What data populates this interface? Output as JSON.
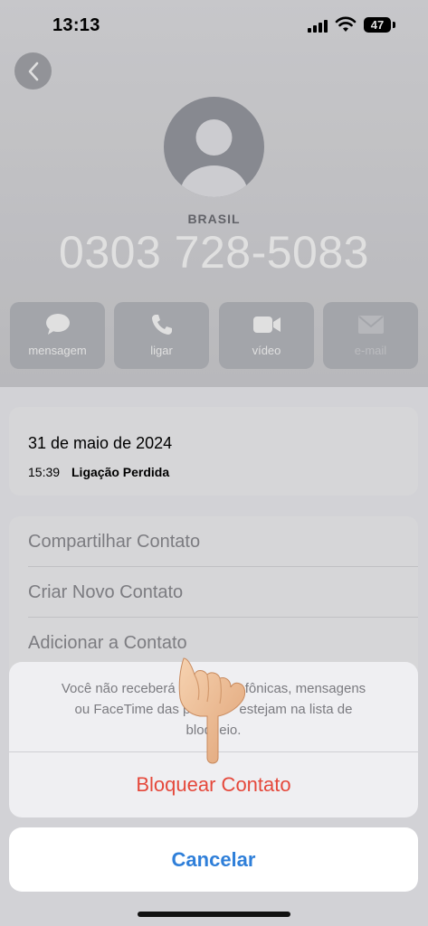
{
  "status_bar": {
    "time": "13:13",
    "battery": "47"
  },
  "contact": {
    "country": "BRASIL",
    "phone": "0303 728-5083"
  },
  "actions": [
    {
      "label": "mensagem",
      "icon": "message-icon"
    },
    {
      "label": "ligar",
      "icon": "phone-icon"
    },
    {
      "label": "vídeo",
      "icon": "video-icon"
    },
    {
      "label": "e-mail",
      "icon": "mail-icon"
    }
  ],
  "call_history": {
    "date": "31 de maio de 2024",
    "time": "15:39",
    "status": "Ligação Perdida"
  },
  "options": [
    {
      "label": "Compartilhar Contato"
    },
    {
      "label": "Criar Novo Contato"
    },
    {
      "label": "Adicionar a Contato"
    }
  ],
  "action_sheet": {
    "message_line1": "Você não receberá li",
    "message_line1_end": "telefônicas, mensagens",
    "message_line2_start": "ou FaceTime das p",
    "message_line2_end": "estejam na lista de",
    "message_line3": "bloqueio.",
    "block_label": "Bloquear Contato",
    "cancel_label": "Cancelar"
  },
  "colors": {
    "destructive": "#e5483b",
    "accent": "#2f7fd9"
  }
}
